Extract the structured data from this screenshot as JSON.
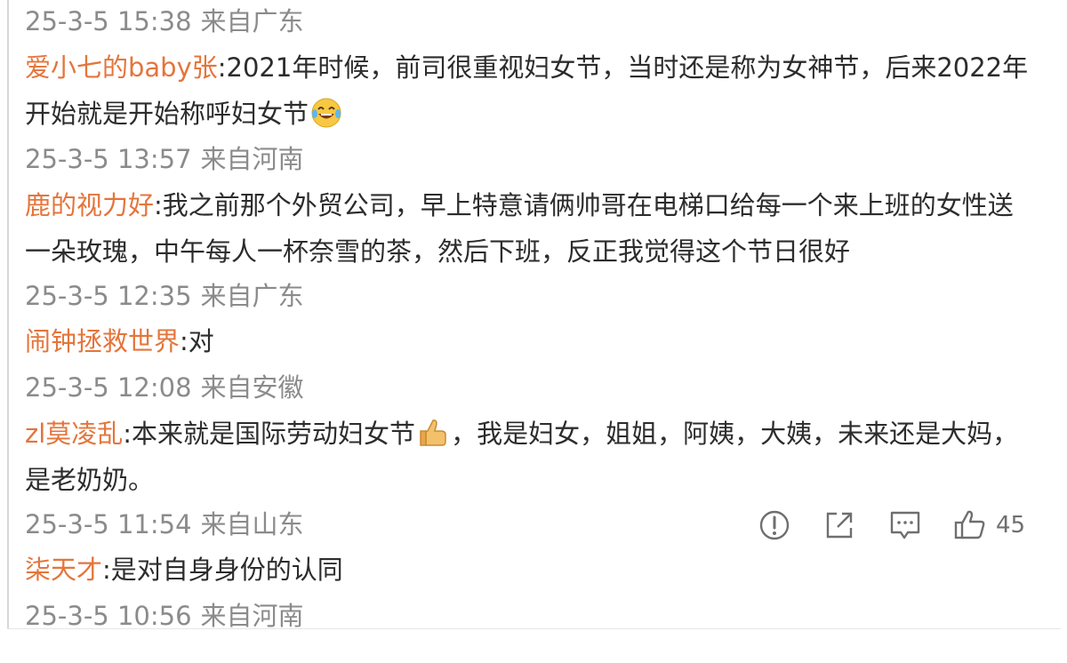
{
  "comments": [
    {
      "time": "25-3-5 15:38",
      "location": "来自广东",
      "user": "爱小七的baby张",
      "text_a": ":2021年时候，前司很重视妇女节，当时还是称为女神节，后来2022年开始就是开始称呼妇女节",
      "emoji": "laughing-tears-emoji"
    },
    {
      "time": "25-3-5 13:57",
      "location": "来自河南",
      "user": "鹿的视力好",
      "text_a": ":我之前那个外贸公司，早上特意请俩帅哥在电梯口给每一个来上班的女性送一朵玫瑰，中午每人一杯奈雪的茶，然后下班，反正我觉得这个节日很好"
    },
    {
      "time": "25-3-5 12:35",
      "location": "来自广东",
      "user": "闹钟拯救世界",
      "text_a": ":对"
    },
    {
      "time": "25-3-5 12:08",
      "location": "来自安徽",
      "user": "zl莫凌乱",
      "text_a": ":本来就是国际劳动妇女节",
      "emoji": "thumbs-up-emoji",
      "text_b": "，我是妇女，姐姐，阿姨，大姨，未来还是大妈，是老奶奶。"
    },
    {
      "time": "25-3-5 11:54",
      "location": "来自山东",
      "user": "柒天才",
      "text_a": ":是对自身身份的认同"
    },
    {
      "time": "25-3-5 10:56",
      "location": "来自河南"
    }
  ],
  "actions": {
    "like_count": "45",
    "icons": [
      "report-icon",
      "share-icon",
      "comment-icon",
      "like-icon"
    ]
  },
  "colors": {
    "username": "#e4753b",
    "meta": "#8b8b8b",
    "text": "#2c2c2c"
  }
}
